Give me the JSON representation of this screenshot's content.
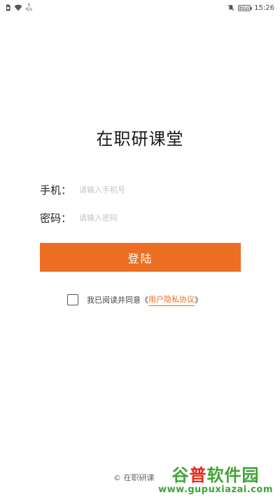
{
  "status_bar": {
    "net_speed_value": "0",
    "net_speed_unit": "K/s",
    "battery_text": "100",
    "battery_level": 1.0,
    "time": "15:26"
  },
  "app": {
    "title": "在职研课堂"
  },
  "form": {
    "phone_label": "手机：",
    "phone_placeholder": "请输入手机号",
    "phone_value": "",
    "password_label": "密码：",
    "password_placeholder": "请输入密码",
    "password_value": ""
  },
  "login_button": {
    "label": "登陆",
    "color": "#ec6e22"
  },
  "agreement": {
    "checked": false,
    "text": "我已阅读并同意",
    "open_bracket": "《",
    "link": "用户隐私协议",
    "close_bracket": "》"
  },
  "footer": {
    "text": "© 在职研课"
  },
  "watermark": {
    "part1": "谷",
    "part2": "普",
    "part3": "软件园",
    "url": "www.gupuxiazai.com"
  }
}
